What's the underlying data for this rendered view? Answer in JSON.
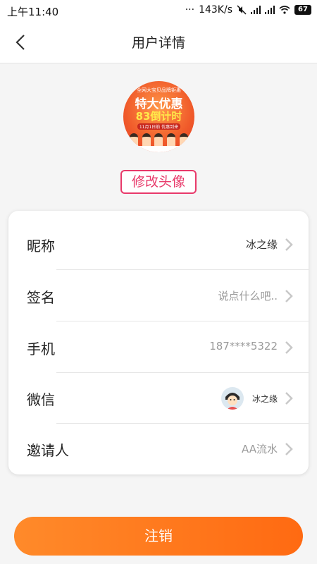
{
  "status_bar": {
    "time": "上午11:40",
    "network_speed": "143K/s",
    "battery_level": "67"
  },
  "nav": {
    "title": "用户详情",
    "back_icon": "chevron-left-icon"
  },
  "avatar": {
    "line1": "全网大宝贝品牌钜惠",
    "line2": "特大优惠",
    "line3": "83倒计时",
    "line4": "11月1日前 优惠到来"
  },
  "change_avatar_label": "修改头像",
  "profile_rows": [
    {
      "label": "昵称",
      "value": "冰之缘"
    },
    {
      "label": "签名",
      "value": "说点什么吧.."
    },
    {
      "label": "手机",
      "value": "187****5322"
    },
    {
      "label": "微信",
      "value": "冰之缘"
    },
    {
      "label": "邀请人",
      "value": "AA流水"
    }
  ],
  "logout_label": "注销",
  "colors": {
    "accent_pink": "#e8396a",
    "button_orange": "#ff7a1e"
  }
}
